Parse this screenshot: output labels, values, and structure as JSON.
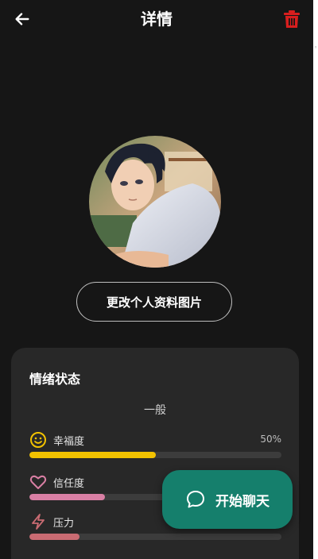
{
  "header": {
    "title": "详情",
    "back_icon": "arrow-left-icon",
    "delete_icon": "trash-icon"
  },
  "profile": {
    "avatar_description_icon": "avatar-image",
    "change_photo_label": "更改个人资料图片"
  },
  "emotion_card": {
    "title": "情绪状态",
    "overall_mood": "一般",
    "metrics": [
      {
        "label": "幸福度",
        "value_text": "50%",
        "level": 0.5,
        "icon": "smile-icon",
        "color": "#f2c200"
      },
      {
        "label": "信任度",
        "value_text": "",
        "level": 0.3,
        "icon": "heart-icon",
        "color": "#d97fa4"
      },
      {
        "label": "压力",
        "value_text": "",
        "level": 0.2,
        "icon": "lightning-icon",
        "color": "#c96b72"
      }
    ]
  },
  "fab": {
    "label": "开始聊天",
    "icon": "chat-bubble-icon",
    "color": "#157f6c"
  },
  "colors": {
    "background": "#161616",
    "card": "#282828",
    "delete": "#d81e1e"
  }
}
